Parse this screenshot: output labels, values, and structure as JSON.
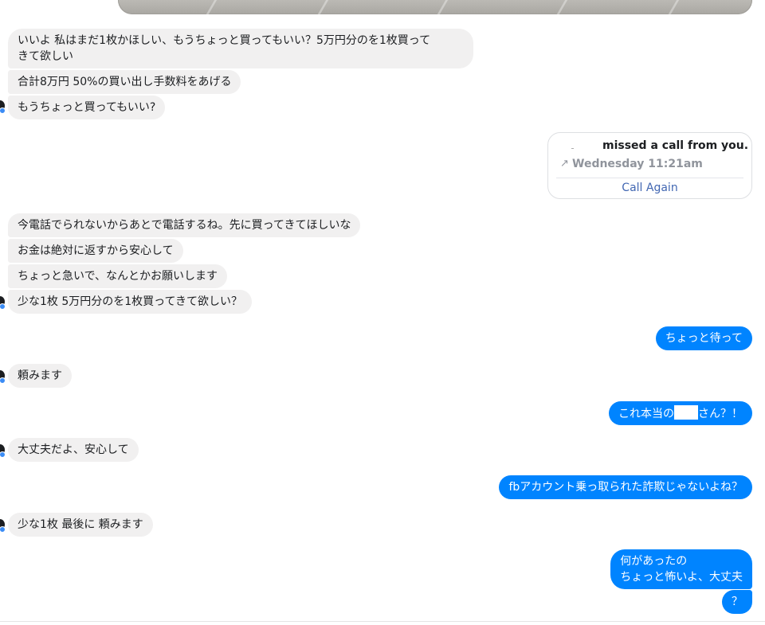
{
  "messages": [
    {
      "side": "in",
      "text": "いいよ  私はまだ1枚かほしい、もうちょっと買ってもいい？5万円分のを1枚買って\nきて欲しい"
    },
    {
      "side": "in",
      "text": "合計8万円   50%の買い出し手数料をあげる"
    },
    {
      "side": "in",
      "text": "もうちょっと買ってもいい?"
    },
    {
      "side": "in",
      "text": "今電話でられないからあとで電話するね。先に買ってきてほしいな"
    },
    {
      "side": "in",
      "text": "お金は絶対に返すから安心して"
    },
    {
      "side": "in",
      "text": "ちょっと急いで、なんとかお願いします"
    },
    {
      "side": "in",
      "text": "少な1枚   5万円分のを1枚買ってきて欲しい？"
    },
    {
      "side": "out",
      "text": "ちょっと待って"
    },
    {
      "side": "in",
      "text": "頼みます"
    },
    {
      "side": "out",
      "text_before": "これ本当の",
      "text_after": "さん？！"
    },
    {
      "side": "in",
      "text": "大丈夫だよ、安心して"
    },
    {
      "side": "out",
      "text": "fbアカウント乗っ取られた詐欺じゃないよね？"
    },
    {
      "side": "in",
      "text": "少な1枚    最後に  頼みます"
    },
    {
      "side": "out",
      "text": "何があったの\nちょっと怖いよ、大丈夫"
    },
    {
      "side": "out",
      "text": "？"
    }
  ],
  "call": {
    "title": "missed a call from you.",
    "arrow": "↗",
    "time": "Wednesday 11:21am",
    "action": "Call Again"
  },
  "colors": {
    "incoming": "#f1f0f0",
    "outgoing": "#0084ff",
    "link": "#4267b2"
  }
}
